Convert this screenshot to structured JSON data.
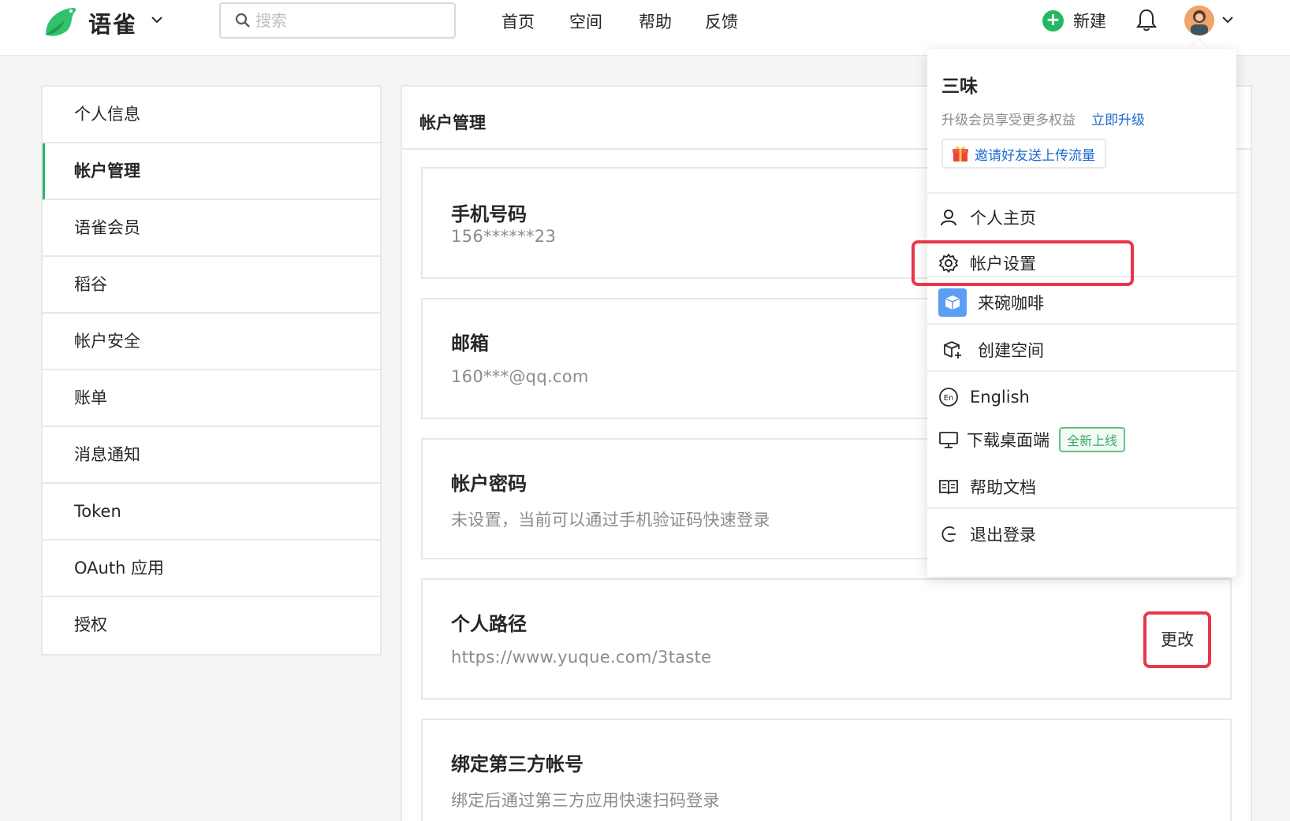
{
  "header": {
    "brand": "语雀",
    "search_placeholder": "搜索",
    "nav": [
      "首页",
      "空间",
      "帮助",
      "反馈"
    ],
    "new_label": "新建"
  },
  "sidebar": {
    "items": [
      {
        "label": "个人信息",
        "active": false
      },
      {
        "label": "帐户管理",
        "active": true
      },
      {
        "label": "语雀会员",
        "active": false
      },
      {
        "label": "稻谷",
        "active": false
      },
      {
        "label": "帐户安全",
        "active": false
      },
      {
        "label": "账单",
        "active": false
      },
      {
        "label": "消息通知",
        "active": false
      },
      {
        "label": "Token",
        "active": false
      },
      {
        "label": "OAuth 应用",
        "active": false
      },
      {
        "label": "授权",
        "active": false
      }
    ]
  },
  "main": {
    "title": "帐户管理",
    "cards": [
      {
        "title": "手机号码",
        "value": "156******23"
      },
      {
        "title": "邮箱",
        "value": "160***@qq.com"
      },
      {
        "title": "帐户密码",
        "value": "未设置，当前可以通过手机验证码快速登录"
      },
      {
        "title": "个人路径",
        "value": "https://www.yuque.com/3taste",
        "action": "更改"
      },
      {
        "title": "绑定第三方帐号",
        "value": "绑定后通过第三方应用快速扫码登录"
      }
    ]
  },
  "dropdown": {
    "username": "三味",
    "upgrade_text": "升级会员享受更多权益",
    "upgrade_link": "立即升级",
    "invite": "邀请好友送上传流量",
    "items": {
      "profile": "个人主页",
      "settings": "帐户设置",
      "coffee": "来碗咖啡",
      "create_space": "创建空间",
      "language": "English",
      "download": "下载桌面端",
      "download_tag": "全新上线",
      "help_docs": "帮助文档",
      "logout": "退出登录"
    }
  },
  "colors": {
    "brand_green": "#25b864",
    "link_blue": "#1b6ad0",
    "highlight_red": "#e8364b"
  }
}
